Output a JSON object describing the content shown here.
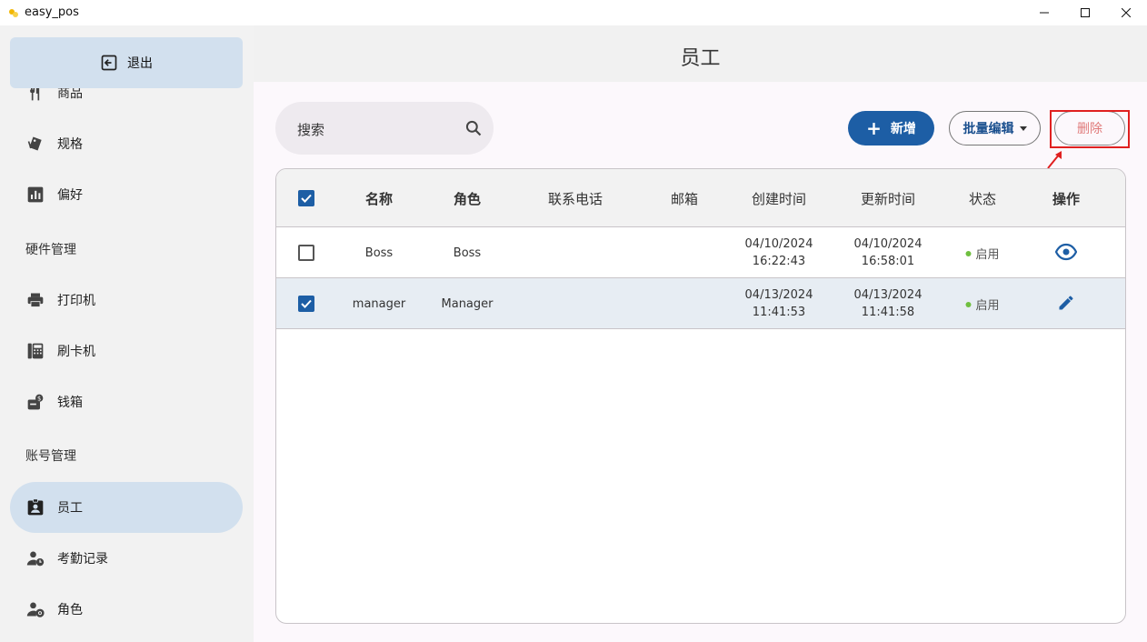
{
  "window": {
    "title": "easy_pos"
  },
  "sidebar": {
    "logout_label": "退出",
    "items_top": [
      {
        "label": "商品",
        "icon": "utensils-icon"
      },
      {
        "label": "规格",
        "icon": "tags-icon"
      },
      {
        "label": "偏好",
        "icon": "chart-box-icon"
      }
    ],
    "section_hardware": "硬件管理",
    "items_hardware": [
      {
        "label": "打印机",
        "icon": "printer-icon"
      },
      {
        "label": "刷卡机",
        "icon": "card-reader-icon"
      },
      {
        "label": "钱箱",
        "icon": "cash-box-icon"
      }
    ],
    "section_account": "账号管理",
    "items_account": [
      {
        "label": "员工",
        "icon": "badge-icon",
        "active": true
      },
      {
        "label": "考勤记录",
        "icon": "user-clock-icon"
      },
      {
        "label": "角色",
        "icon": "user-gear-icon"
      }
    ]
  },
  "header": {
    "title": "员工"
  },
  "toolbar": {
    "search_placeholder": "搜索",
    "new_label": "新增",
    "batch_edit_label": "批量编辑",
    "delete_label": "删除"
  },
  "table": {
    "columns": [
      "名称",
      "角色",
      "联系电话",
      "邮箱",
      "创建时间",
      "更新时间",
      "状态",
      "操作"
    ],
    "rows": [
      {
        "checked": false,
        "name": "Boss",
        "role": "Boss",
        "phone": "",
        "email": "",
        "created_date": "04/10/2024",
        "created_time": "16:22:43",
        "updated_date": "04/10/2024",
        "updated_time": "16:58:01",
        "status": "启用",
        "action_icon": "eye-icon"
      },
      {
        "checked": true,
        "name": "manager",
        "role": "Manager",
        "phone": "",
        "email": "",
        "created_date": "04/13/2024",
        "created_time": "11:41:53",
        "updated_date": "04/13/2024",
        "updated_time": "11:41:58",
        "status": "启用",
        "action_icon": "pencil-icon"
      }
    ]
  },
  "colors": {
    "accent": "#1d5ea5",
    "sidebar_active": "#d2e0ee",
    "status_on": "#6fbf3f",
    "delete_text": "#e07a7a",
    "highlight": "#e02020"
  }
}
